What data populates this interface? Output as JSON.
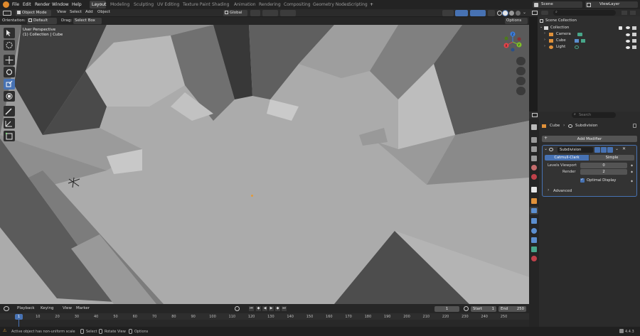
{
  "topbar": {
    "menus": [
      "File",
      "Edit",
      "Render",
      "Window",
      "Help"
    ],
    "workspaces": [
      "Layout",
      "Modeling",
      "Sculpting",
      "UV Editing",
      "Texture Paint",
      "Shading",
      "Animation",
      "Rendering",
      "Compositing",
      "Geometry Nodes",
      "Scripting"
    ],
    "add_tab": "+",
    "scene_label": "Scene",
    "viewlayer_label": "ViewLayer"
  },
  "viewport_header": {
    "mode": "Object Mode",
    "menus": [
      "View",
      "Select",
      "Add",
      "Object"
    ],
    "transform_orientation": "Global",
    "options": "Options"
  },
  "tool_header": {
    "orientation_label": "Orientation:",
    "orientation_value": "Default",
    "drag_label": "Drag:",
    "drag_value": "Select Box"
  },
  "viewport": {
    "info_line1": "User Perspective",
    "info_line2": "(1) Collection | Cube",
    "gizmo_axes": [
      "X",
      "Y",
      "Z"
    ]
  },
  "outliner": {
    "search_placeholder": "",
    "root": "Scene Collection",
    "collection": "Collection",
    "items": [
      "Camera",
      "Cube",
      "Light"
    ]
  },
  "properties": {
    "search_placeholder": "Search",
    "breadcrumb_object": "Cube",
    "breadcrumb_modifier": "Subdivision",
    "add_modifier": "Add Modifier",
    "modifier_name": "Subdivision",
    "type_catmull": "Catmull-Clark",
    "type_simple": "Simple",
    "levels_viewport_label": "Levels Viewport",
    "levels_viewport_value": "0",
    "render_label": "Render",
    "render_value": "2",
    "optimal_display_label": "Optimal Display",
    "advanced_label": "Advanced"
  },
  "timeline": {
    "menus": [
      "Playback",
      "Keying",
      "View",
      "Marker"
    ],
    "current_frame": "1",
    "start_label": "Start",
    "start_value": "1",
    "end_label": "End",
    "end_value": "250",
    "ruler": [
      "1",
      "10",
      "20",
      "30",
      "40",
      "50",
      "60",
      "70",
      "80",
      "90",
      "100",
      "110",
      "120",
      "130",
      "140",
      "150",
      "160",
      "170",
      "180",
      "190",
      "200",
      "210",
      "220",
      "230",
      "240",
      "250"
    ]
  },
  "status": {
    "message": "Active object has non-uniform scale",
    "select": "Select",
    "rotate_view": "Rotate View",
    "options": "Options",
    "version": "4.4.3"
  },
  "colors": {
    "accent": "#4772b3",
    "header_bg": "#232323",
    "panel_bg": "#303030",
    "viewport_floor": "#a9a9a9"
  }
}
